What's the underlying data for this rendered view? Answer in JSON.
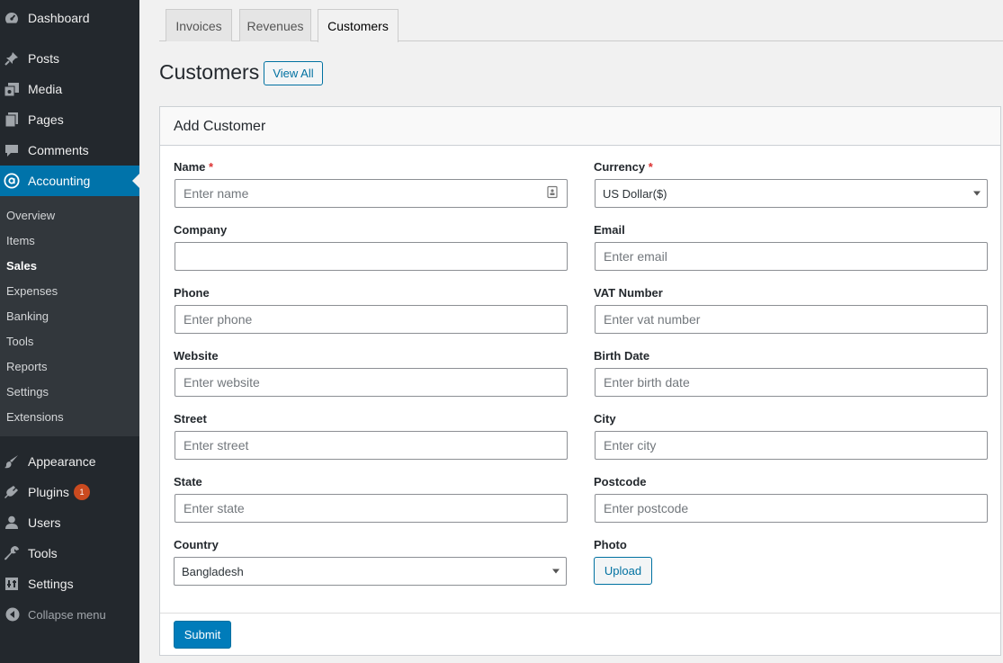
{
  "sidebar": {
    "dashboard": {
      "label": "Dashboard",
      "icon": "dashboard-icon"
    },
    "posts": {
      "label": "Posts",
      "icon": "pin-icon"
    },
    "media": {
      "label": "Media",
      "icon": "media-icon"
    },
    "pages": {
      "label": "Pages",
      "icon": "pages-icon"
    },
    "comments": {
      "label": "Comments",
      "icon": "comment-icon"
    },
    "accounting": {
      "label": "Accounting",
      "icon": "accounting-icon"
    },
    "accounting_submenu": [
      "Overview",
      "Items",
      "Sales",
      "Expenses",
      "Banking",
      "Tools",
      "Reports",
      "Settings",
      "Extensions"
    ],
    "current_submenu": "Sales",
    "appearance": {
      "label": "Appearance",
      "icon": "brush-icon"
    },
    "plugins": {
      "label": "Plugins",
      "icon": "plugin-icon",
      "badge": "1"
    },
    "users": {
      "label": "Users",
      "icon": "user-icon"
    },
    "tools": {
      "label": "Tools",
      "icon": "wrench-icon"
    },
    "settings": {
      "label": "Settings",
      "icon": "settings-icon"
    },
    "collapse": {
      "label": "Collapse menu",
      "icon": "collapse-icon"
    }
  },
  "tabs": [
    "Invoices",
    "Revenues",
    "Customers"
  ],
  "active_tab": "Customers",
  "page": {
    "title": "Customers",
    "view_all": "View All"
  },
  "form": {
    "title": "Add Customer",
    "required_mark": "*",
    "name": {
      "label": "Name",
      "placeholder": "Enter name"
    },
    "currency": {
      "label": "Currency",
      "value": "US Dollar($)"
    },
    "company": {
      "label": "Company",
      "placeholder": ""
    },
    "email": {
      "label": "Email",
      "placeholder": "Enter email"
    },
    "phone": {
      "label": "Phone",
      "placeholder": "Enter phone"
    },
    "vat": {
      "label": "VAT Number",
      "placeholder": "Enter vat number"
    },
    "website": {
      "label": "Website",
      "placeholder": "Enter website"
    },
    "birth_date": {
      "label": "Birth Date",
      "placeholder": "Enter birth date"
    },
    "street": {
      "label": "Street",
      "placeholder": "Enter street"
    },
    "city": {
      "label": "City",
      "placeholder": "Enter city"
    },
    "state": {
      "label": "State",
      "placeholder": "Enter state"
    },
    "postcode": {
      "label": "Postcode",
      "placeholder": "Enter postcode"
    },
    "country": {
      "label": "Country",
      "value": "Bangladesh"
    },
    "photo": {
      "label": "Photo",
      "upload": "Upload"
    },
    "submit": "Submit"
  },
  "colors": {
    "sidebar_bg": "#23282d",
    "submenu_bg": "#32373c",
    "accent": "#0073aa",
    "badge": "#ca4a1f",
    "required": "#dc3232"
  }
}
